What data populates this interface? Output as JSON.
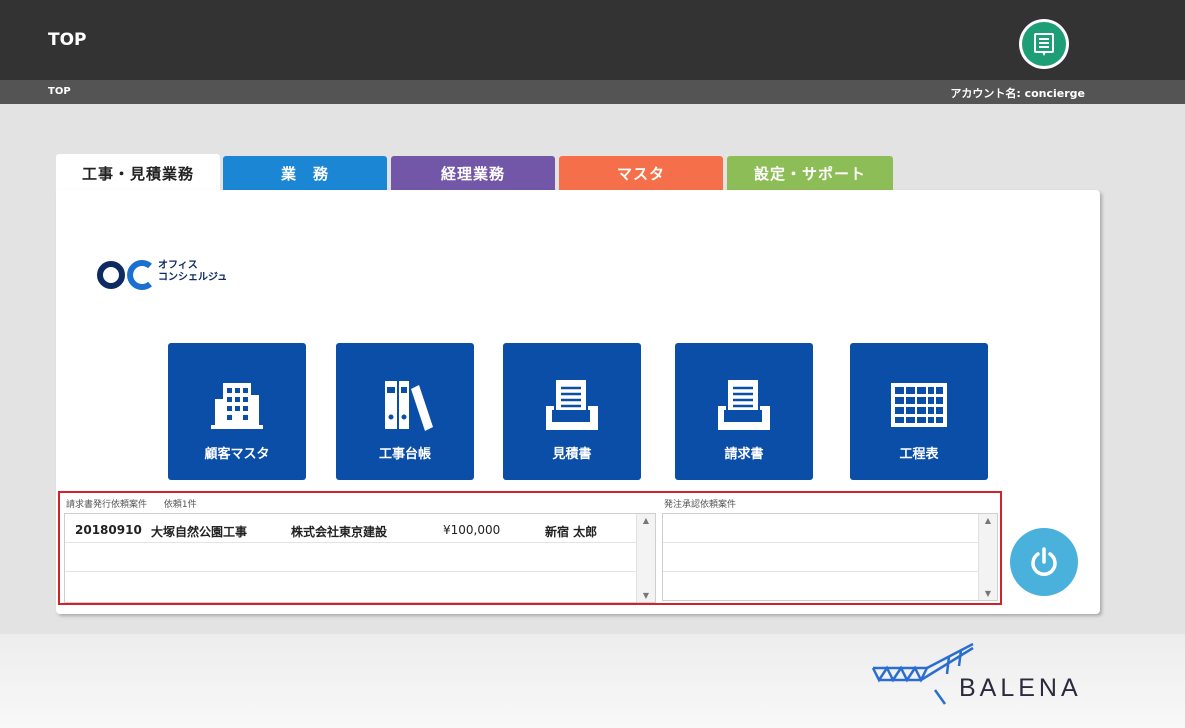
{
  "header": {
    "title": "TOP",
    "breadcrumb": "TOP",
    "account": "アカウント名: concierge",
    "menu_icon": "document-list-icon"
  },
  "tabs": [
    {
      "label": "工事・見積業務",
      "color": "#ffffff",
      "active": true
    },
    {
      "label": "業　務",
      "color": "#1a86d4",
      "active": false
    },
    {
      "label": "経理業務",
      "color": "#7256a8",
      "active": false
    },
    {
      "label": "マスタ",
      "color": "#f5704a",
      "active": false
    },
    {
      "label": "設定・サポート",
      "color": "#8dbd56",
      "active": false
    }
  ],
  "logo": {
    "line1": "オフィス",
    "line2": "コンシェルジュ"
  },
  "tiles": [
    {
      "label": "顧客マスタ",
      "icon": "building-icon"
    },
    {
      "label": "工事台帳",
      "icon": "binders-icon"
    },
    {
      "label": "見積書",
      "icon": "document-tray-icon"
    },
    {
      "label": "請求書",
      "icon": "document-tray-icon"
    },
    {
      "label": "工程表",
      "icon": "calendar-grid-icon"
    }
  ],
  "invoice_requests": {
    "title": "請求書発行依頼案件",
    "count_text": "依頼1件",
    "rows": [
      {
        "date": "20180910",
        "project": "大塚自然公園工事",
        "company": "株式会社東京建設",
        "amount": "¥100,000",
        "person": "新宿 太郎"
      }
    ]
  },
  "order_approvals": {
    "title": "発注承認依頼案件"
  },
  "footer": {
    "brand": "BALENA"
  },
  "colors": {
    "tile": "#0b4ea8",
    "topbar": "#333333",
    "power": "#4ab0dc",
    "highlight_border": "#d0232a"
  }
}
